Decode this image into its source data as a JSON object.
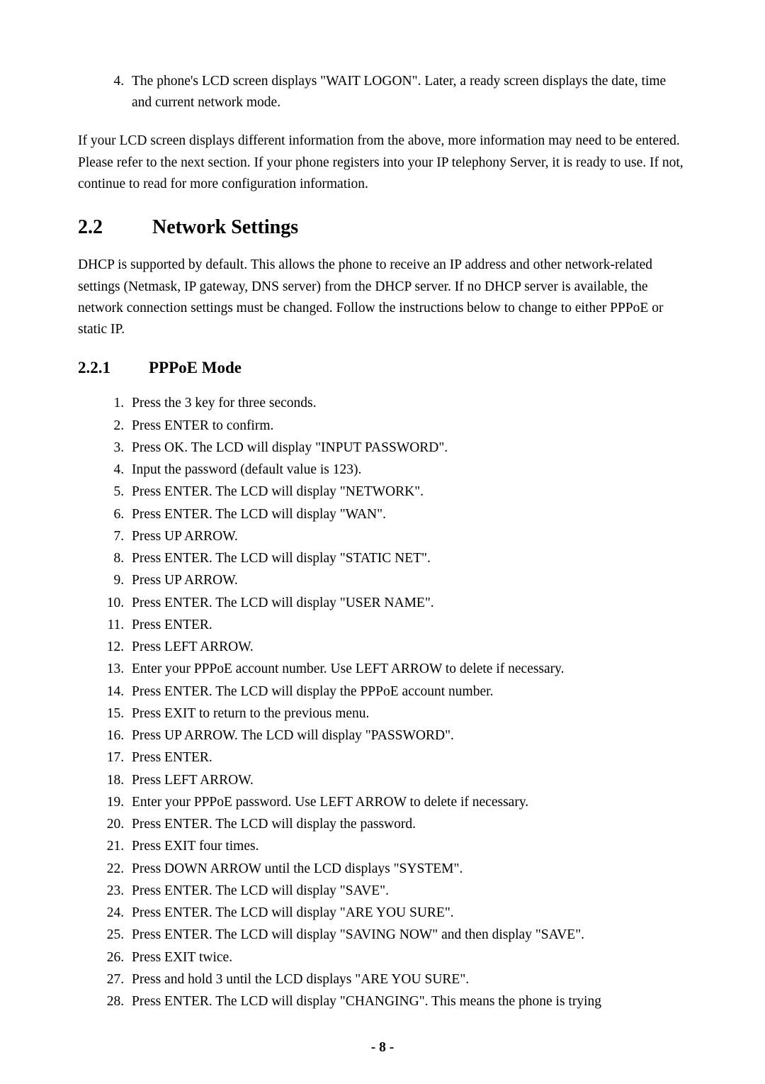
{
  "intro": {
    "step4": "The phone's LCD screen displays \"WAIT LOGON\". Later, a ready screen displays the date, time and current network mode."
  },
  "para_lcd_info": "If your LCD screen displays different information from the above, more information may need to be entered.    Please refer to the next section.    If your phone registers into your IP telephony Server, it is ready to use.    If not, continue to read for more configuration information.",
  "heading_22_num": "2.2",
  "heading_22_title": "Network Settings",
  "para_dhcp": "DHCP is supported by default.    This allows the phone to receive an IP address and other network-related settings (Netmask, IP gateway, DNS server) from the DHCP server.    If no DHCP server is available, the network connection settings must be changed.    Follow the instructions below to change to either PPPoE or static IP.",
  "heading_221_num": "2.2.1",
  "heading_221_title": "PPPoE Mode",
  "steps": [
    "Press the 3 key for three seconds.",
    "Press ENTER to confirm.",
    "Press OK.    The LCD will display \"INPUT PASSWORD\".",
    "Input the password (default value is 123).",
    "Press ENTER. The LCD will display \"NETWORK\".",
    "Press ENTER. The LCD will display \"WAN\".",
    "Press UP ARROW.",
    "Press ENTER. The LCD will display \"STATIC NET\".",
    "Press UP ARROW.",
    "Press ENTER. The LCD will display \"USER NAME\".",
    "Press ENTER.",
    "Press LEFT ARROW.",
    "Enter your PPPoE account number. Use LEFT ARROW to delete if necessary.",
    "Press ENTER. The LCD will display the PPPoE account number.",
    "Press EXIT to return to the previous menu.",
    "Press UP ARROW.    The LCD will display \"PASSWORD\".",
    "Press ENTER.",
    "Press LEFT ARROW.",
    "Enter your PPPoE password. Use LEFT ARROW to delete if necessary.",
    "Press ENTER.    The LCD will display the password.",
    "Press EXIT four times.",
    "Press DOWN ARROW until the LCD displays \"SYSTEM\".",
    "Press ENTER. The LCD will display \"SAVE\".",
    "Press ENTER. The LCD will display \"ARE YOU SURE\".",
    "Press ENTER. The LCD will display \"SAVING NOW\" and then display \"SAVE\".",
    "Press EXIT twice.",
    "Press and hold 3 until the LCD displays \"ARE YOU SURE\".",
    "Press ENTER.    The LCD will display \"CHANGING\".    This means the phone is trying"
  ],
  "page_number": "- 8 -"
}
